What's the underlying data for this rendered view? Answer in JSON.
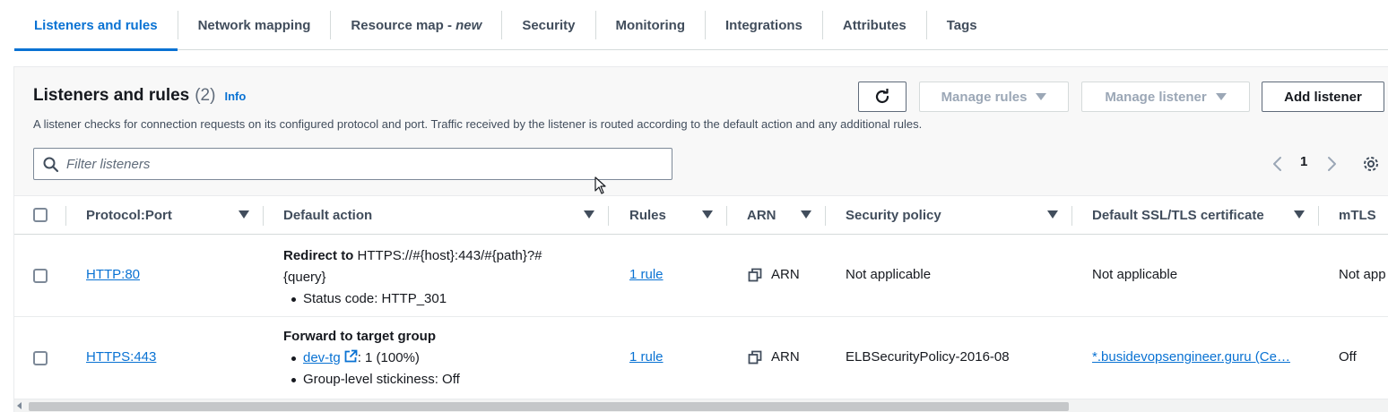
{
  "tabs": [
    {
      "label": "Listeners and rules"
    },
    {
      "label": "Network mapping"
    },
    {
      "label": "Resource map - ",
      "suffix": "new"
    },
    {
      "label": "Security"
    },
    {
      "label": "Monitoring"
    },
    {
      "label": "Integrations"
    },
    {
      "label": "Attributes"
    },
    {
      "label": "Tags"
    }
  ],
  "header": {
    "title": "Listeners and rules",
    "count": "(2)",
    "info": "Info",
    "description": "A listener checks for connection requests on its configured protocol and port. Traffic received by the listener is routed according to the default action and any additional rules."
  },
  "buttons": {
    "manage_rules": "Manage rules",
    "manage_listener": "Manage listener",
    "add_listener": "Add listener"
  },
  "filter": {
    "placeholder": "Filter listeners"
  },
  "pagination": {
    "page": "1"
  },
  "table": {
    "columns": [
      "Protocol:Port",
      "Default action",
      "Rules",
      "ARN",
      "Security policy",
      "Default SSL/TLS certificate",
      "mTLS"
    ],
    "rows": [
      {
        "protocol": "HTTP:80",
        "action_title": "Redirect to",
        "action_target_1": "HTTPS://#{host}:443/#{path}?#",
        "action_target_2": "{query}",
        "bullet_1": "Status code: HTTP_301",
        "rules": "1 rule",
        "arn": "ARN",
        "security_policy": "Not applicable",
        "certificate": "Not applicable",
        "mtls": "Not app"
      },
      {
        "protocol": "HTTPS:443",
        "action_title": "Forward to target group",
        "target_group": "dev-tg",
        "target_weight": ": 1 (100%)",
        "bullet_2": "Group-level stickiness: Off",
        "rules": "1 rule",
        "arn": "ARN",
        "security_policy": "ELBSecurityPolicy-2016-08",
        "certificate": "*.busidevopsengineer.guru (Ce…",
        "mtls": "Off"
      }
    ]
  },
  "colors": {
    "accent": "#0972d3",
    "text": "#16191f",
    "muted": "#414d5c",
    "border": "#d5dbdb"
  }
}
